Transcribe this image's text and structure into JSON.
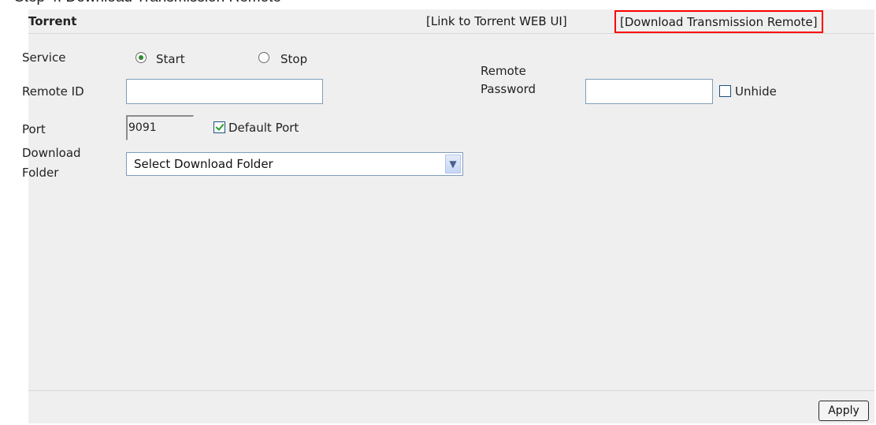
{
  "top_clipped_text": "Step 4: Download Transmission Remote",
  "panel": {
    "title": "Torrent",
    "link_webui": "[Link to Torrent WEB UI]",
    "link_remote": "[Download Transmission Remote]",
    "highlight_color": "#ff0000"
  },
  "service": {
    "label": "Service",
    "option_start": "Start",
    "option_stop": "Stop",
    "selected": "Start"
  },
  "remote_id": {
    "label": "Remote ID",
    "value": ""
  },
  "remote_password": {
    "label_line1": "Remote",
    "label_line2": "Password",
    "value": ""
  },
  "unhide": {
    "label": "Unhide",
    "checked": false
  },
  "port": {
    "label": "Port",
    "value": "9091"
  },
  "default_port": {
    "label": "Default Port",
    "checked": true
  },
  "download_folder": {
    "label_line1": "Download",
    "label_line2": "Folder",
    "selected": "Select Download Folder",
    "arrow_icon": "chevron-down-icon"
  },
  "apply_label": "Apply"
}
